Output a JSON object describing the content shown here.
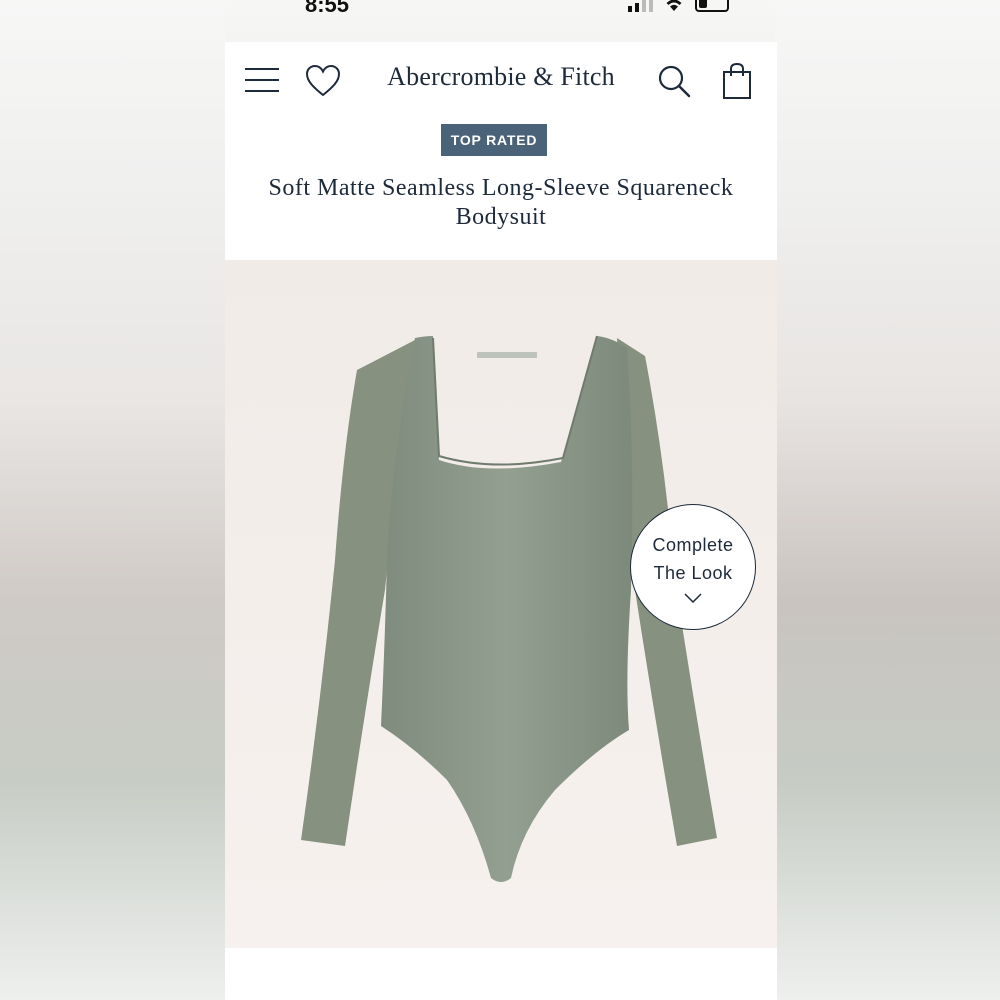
{
  "status_bar": {
    "time": "8:55"
  },
  "header": {
    "brand": "Abercrombie & Fitch",
    "icons": [
      "menu-icon",
      "heart-icon",
      "search-icon",
      "bag-icon"
    ]
  },
  "product": {
    "badge": "TOP RATED",
    "title": "Soft Matte Seamless Long-Sleeve Squareneck Bodysuit",
    "image_alt_color": "#909c8e"
  },
  "complete_look": {
    "line1": "Complete",
    "line2": "The Look"
  },
  "colors": {
    "navy": "#1d2a3a",
    "badge_bg": "#4a6379",
    "garment": "#8e9a8c"
  }
}
